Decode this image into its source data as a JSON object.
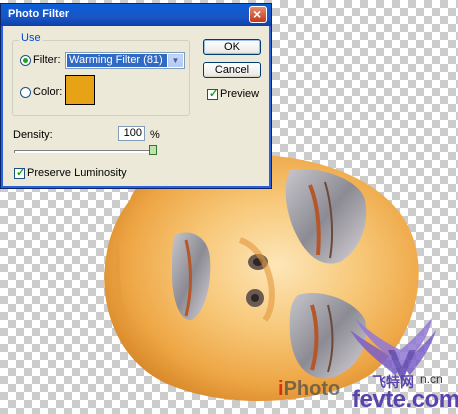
{
  "dialog": {
    "title": "Photo Filter",
    "use_label": "Use",
    "filter_radio_label": "Filter:",
    "filter_selected": "Warming Filter (81)",
    "color_radio_label": "Color:",
    "color_swatch": "#e8a216",
    "ok_label": "OK",
    "cancel_label": "Cancel",
    "preview_label": "Preview",
    "density_label": "Density:",
    "density_value": "100",
    "density_unit": "%",
    "preserve_label": "Preserve Luminosity",
    "density_level": 1.0
  },
  "watermark": {
    "site_partial": "iPhoto",
    "site_suffix": "n.cn",
    "cn_text": "飞特网",
    "domain_text": "fevte.com"
  },
  "colors": {
    "titlebar": "#0a5fd8",
    "dialog_bg": "#ece9d8",
    "skin": "#f2b35a"
  }
}
